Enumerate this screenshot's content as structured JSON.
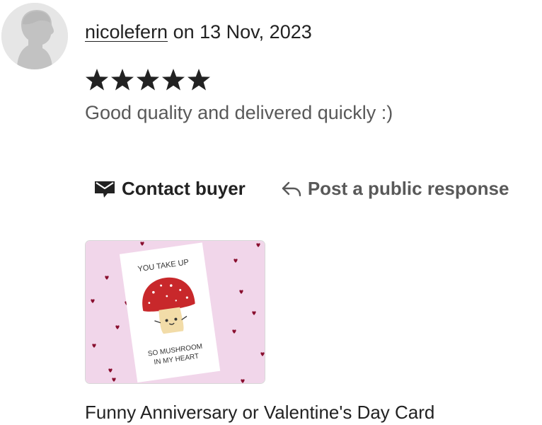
{
  "review": {
    "username": "nicolefern",
    "date_text": "on 13 Nov, 2023",
    "rating": 5,
    "rating_max": 5,
    "text": "Good quality and delivered quickly :)"
  },
  "actions": {
    "contact_label": "Contact buyer",
    "contact_icon": "envelope-icon",
    "respond_label": "Post a public response",
    "respond_icon": "reply-arrow-icon"
  },
  "listing": {
    "title": "Funny Anniversary or Valentine's Day Card",
    "card_text_top": "YOU TAKE UP",
    "card_text_bottom_line1": "SO MUSHROOM",
    "card_text_bottom_line2": "IN MY HEART"
  },
  "colors": {
    "text_primary": "#222222",
    "text_secondary": "#595959",
    "image_background": "#f1d6ea",
    "heart": "#8a1030",
    "mushroom_cap": "#c8282b"
  }
}
